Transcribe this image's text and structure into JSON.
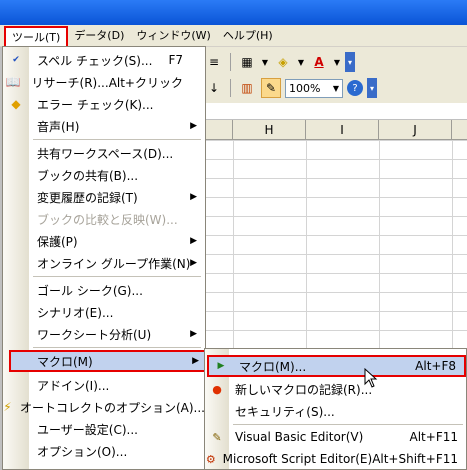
{
  "menubar": {
    "items": [
      {
        "label": "ツール(T)",
        "active": true
      },
      {
        "label": "データ(D)"
      },
      {
        "label": "ウィンドウ(W)"
      },
      {
        "label": "ヘルプ(H)"
      }
    ]
  },
  "toolbar": {
    "zoom_value": "100%"
  },
  "sheet": {
    "column_headers": [
      "H",
      "I",
      "J"
    ]
  },
  "tools_menu": {
    "items": [
      {
        "label": "スペル チェック(S)...",
        "shortcut": "F7"
      },
      {
        "label": "リサーチ(R)...",
        "shortcut": "Alt+クリック"
      },
      {
        "label": "エラー チェック(K)..."
      },
      {
        "label": "音声(H)"
      },
      {
        "label": "共有ワークスペース(D)..."
      },
      {
        "label": "ブックの共有(B)..."
      },
      {
        "label": "変更履歴の記録(T)"
      },
      {
        "label": "ブックの比較と反映(W)..."
      },
      {
        "label": "保護(P)"
      },
      {
        "label": "オンライン グループ作業(N)"
      },
      {
        "label": "ゴール シーク(G)..."
      },
      {
        "label": "シナリオ(E)..."
      },
      {
        "label": "ワークシート分析(U)"
      },
      {
        "label": "マクロ(M)"
      },
      {
        "label": "アドイン(I)..."
      },
      {
        "label": "オートコレクトのオプション(A)..."
      },
      {
        "label": "ユーザー設定(C)..."
      },
      {
        "label": "オプション(O)..."
      }
    ]
  },
  "macro_submenu": {
    "items": [
      {
        "label": "マクロ(M)...",
        "shortcut": "Alt+F8"
      },
      {
        "label": "新しいマクロの記録(R)..."
      },
      {
        "label": "セキュリティ(S)..."
      },
      {
        "label": "Visual Basic Editor(V)",
        "shortcut": "Alt+F11"
      },
      {
        "label": "Microsoft Script Editor(E)",
        "shortcut": "Alt+Shift+F11"
      }
    ]
  },
  "colors": {
    "highlight_border": "#e60000",
    "highlight_fill": "#c1d2ee",
    "menu_bg": "#ffffff",
    "toolbar_bg": "#ece9d8"
  }
}
